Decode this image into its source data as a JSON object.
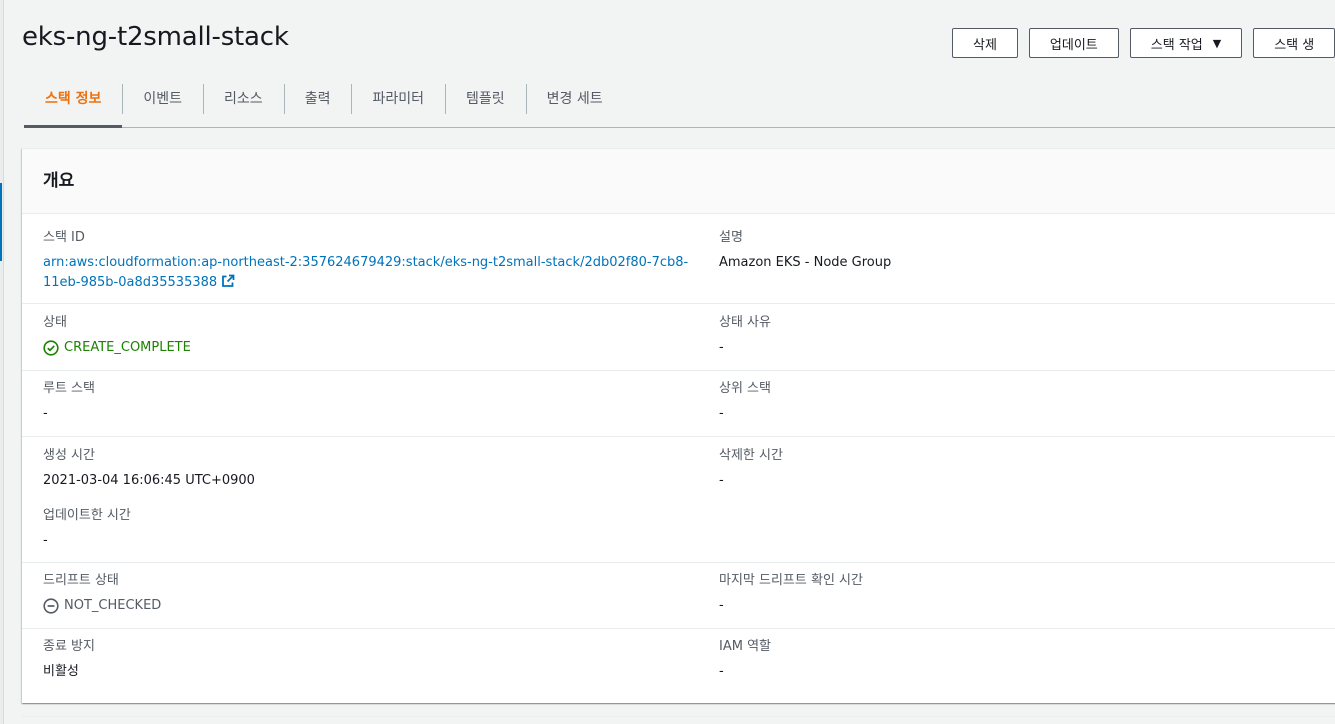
{
  "header": {
    "title": "eks-ng-t2small-stack",
    "actions": {
      "delete_label": "삭제",
      "update_label": "업데이트",
      "stack_actions_label": "스택 작업",
      "create_stack_label": "스택 생"
    }
  },
  "tabs": [
    {
      "label": "스택 정보",
      "active": true
    },
    {
      "label": "이벤트",
      "active": false
    },
    {
      "label": "리소스",
      "active": false
    },
    {
      "label": "출력",
      "active": false
    },
    {
      "label": "파라미터",
      "active": false
    },
    {
      "label": "템플릿",
      "active": false
    },
    {
      "label": "변경 세트",
      "active": false
    }
  ],
  "overview": {
    "title": "개요",
    "stack_id_label": "스택 ID",
    "stack_id_line1": "arn:aws:cloudformation:ap-northeast-2:357624679429:stack/eks-ng-t2small-stack/2db02f80-7cb8-",
    "stack_id_line2": "11eb-985b-0a8d35535388",
    "description_label": "설명",
    "description_value": "Amazon EKS - Node Group",
    "status_label": "상태",
    "status_value": "CREATE_COMPLETE",
    "status_reason_label": "상태 사유",
    "status_reason_value": "-",
    "root_stack_label": "루트 스택",
    "root_stack_value": "-",
    "parent_stack_label": "상위 스택",
    "parent_stack_value": "-",
    "created_time_label": "생성 시간",
    "created_time_value": "2021-03-04 16:06:45 UTC+0900",
    "deleted_time_label": "삭제한 시간",
    "deleted_time_value": "-",
    "updated_time_label": "업데이트한 시간",
    "updated_time_value": "-",
    "drift_status_label": "드리프트 상태",
    "drift_status_value": "NOT_CHECKED",
    "last_drift_check_label": "마지막 드리프트 확인 시간",
    "last_drift_check_value": "-",
    "termination_protection_label": "종료 방지",
    "termination_protection_value": "비활성",
    "iam_role_label": "IAM 역할",
    "iam_role_value": "-"
  },
  "colors": {
    "accent_orange": "#ec7211",
    "link_blue": "#0073bb",
    "success_green": "#1d8102",
    "text_secondary": "#545b64"
  },
  "icons": {
    "status_ok": "check-circle-icon",
    "drift_neutral": "minus-circle-icon",
    "external_link": "external-link-icon"
  }
}
